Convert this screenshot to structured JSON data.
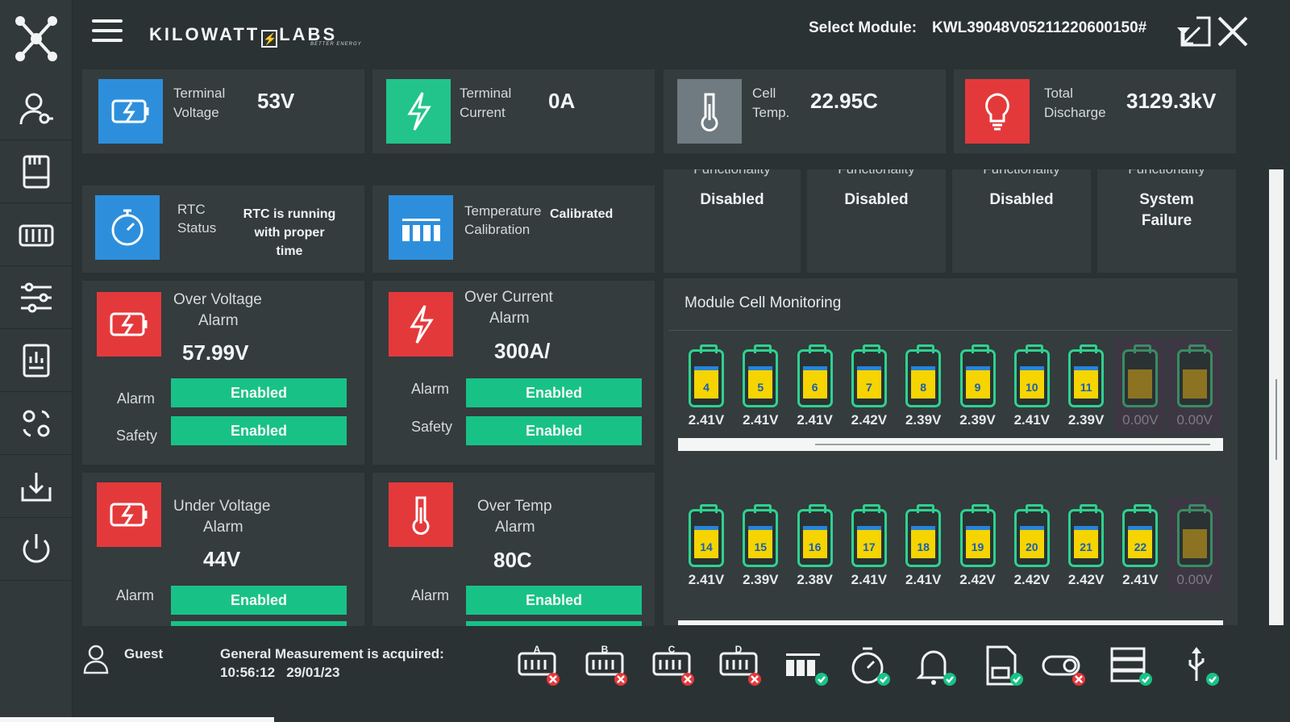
{
  "header": {
    "brand": "KILOWATT",
    "brand_tail": "LABS",
    "tagline": "BETTER ENERGY",
    "select_label": "Select Module:",
    "module_id": "KWL39048V05211220600150#"
  },
  "sidebar": {
    "items": [
      "users-icon",
      "storage-icon",
      "battery-pack-icon",
      "sliders-icon",
      "report-icon",
      "settings-icon",
      "download-icon",
      "power-icon"
    ]
  },
  "top_cards": [
    {
      "label1": "Terminal",
      "label2": "Voltage",
      "value": "53V",
      "color": "#2d8fdc"
    },
    {
      "label1": "Terminal",
      "label2": "Current",
      "value": "0A",
      "color": "#22c48b"
    },
    {
      "label1": "Cell",
      "label2": "Temp.",
      "value": "22.95C",
      "color": "#6f7b80"
    },
    {
      "label1": "Total",
      "label2": "Discharge",
      "value": "3129.3kV",
      "color": "#e4393b"
    }
  ],
  "rtc": {
    "label1": "RTC",
    "label2": "Status",
    "value1": "RTC is running",
    "value2": "with proper",
    "value3": "time"
  },
  "calib": {
    "label1": "Temperature",
    "label2": "Calibration",
    "value": "Calibrated"
  },
  "functionality": [
    {
      "cut": "Functionality",
      "value1": "Disabled",
      "value2": ""
    },
    {
      "cut": "Functionality",
      "value1": "Disabled",
      "value2": ""
    },
    {
      "cut": "Functionality",
      "value1": "Disabled",
      "value2": ""
    },
    {
      "cut": "Functionality",
      "value1": "System",
      "value2": "Failure"
    }
  ],
  "alarms": {
    "over_voltage": {
      "title1": "Over Voltage",
      "title2": "Alarm",
      "value": "57.99V",
      "alarm_label": "Alarm",
      "alarm": "Enabled",
      "safety_label": "Safety",
      "safety": "Enabled"
    },
    "over_current": {
      "title1": "Over Current",
      "title2": "Alarm",
      "value": "300A/",
      "alarm_label": "Alarm",
      "alarm": "Enabled",
      "safety_label": "Safety",
      "safety": "Enabled"
    },
    "under_voltage": {
      "title1": "Under Voltage",
      "title2": "Alarm",
      "value": "44V",
      "alarm_label": "Alarm",
      "alarm": "Enabled"
    },
    "over_temp": {
      "title1": "Over Temp",
      "title2": "Alarm",
      "value": "80C",
      "alarm_label": "Alarm",
      "alarm": "Enabled"
    }
  },
  "monitoring": {
    "title": "Module Cell Monitoring",
    "row1": [
      {
        "n": "4",
        "v": "2.41V",
        "on": true
      },
      {
        "n": "5",
        "v": "2.41V",
        "on": true
      },
      {
        "n": "6",
        "v": "2.41V",
        "on": true
      },
      {
        "n": "7",
        "v": "2.42V",
        "on": true
      },
      {
        "n": "8",
        "v": "2.39V",
        "on": true
      },
      {
        "n": "9",
        "v": "2.39V",
        "on": true
      },
      {
        "n": "10",
        "v": "2.41V",
        "on": true
      },
      {
        "n": "11",
        "v": "2.39V",
        "on": true
      },
      {
        "n": "",
        "v": "0.00V",
        "on": false
      },
      {
        "n": "",
        "v": "0.00V",
        "on": false
      }
    ],
    "row2": [
      {
        "n": "14",
        "v": "2.41V",
        "on": true
      },
      {
        "n": "15",
        "v": "2.39V",
        "on": true
      },
      {
        "n": "16",
        "v": "2.38V",
        "on": true
      },
      {
        "n": "17",
        "v": "2.41V",
        "on": true
      },
      {
        "n": "18",
        "v": "2.41V",
        "on": true
      },
      {
        "n": "19",
        "v": "2.42V",
        "on": true
      },
      {
        "n": "20",
        "v": "2.42V",
        "on": true
      },
      {
        "n": "21",
        "v": "2.42V",
        "on": true
      },
      {
        "n": "22",
        "v": "2.41V",
        "on": true
      },
      {
        "n": "",
        "v": "0.00V",
        "on": false
      }
    ]
  },
  "footer": {
    "user": "Guest",
    "message": "General Measurement is acquired:",
    "time": "10:56:12",
    "date": "29/01/23",
    "icons": [
      {
        "name": "pack-a-icon",
        "letter": "A",
        "ok": false
      },
      {
        "name": "pack-b-icon",
        "letter": "B",
        "ok": false
      },
      {
        "name": "pack-c-icon",
        "letter": "C",
        "ok": false
      },
      {
        "name": "pack-d-icon",
        "letter": "D",
        "ok": false
      },
      {
        "name": "calibration-icon",
        "letter": "",
        "ok": true
      },
      {
        "name": "timer-icon",
        "letter": "",
        "ok": true
      },
      {
        "name": "bell-icon",
        "letter": "",
        "ok": true
      },
      {
        "name": "sd-card-icon",
        "letter": "",
        "ok": true
      },
      {
        "name": "toggle-icon",
        "letter": "",
        "ok": false
      },
      {
        "name": "server-icon",
        "letter": "",
        "ok": true
      },
      {
        "name": "usb-icon",
        "letter": "",
        "ok": true
      }
    ]
  }
}
